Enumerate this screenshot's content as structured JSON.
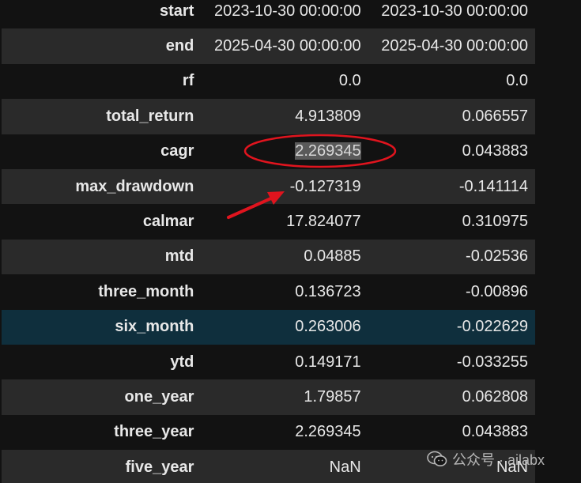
{
  "table": {
    "rows": [
      {
        "label": "start",
        "col1": "2023-10-30 00:00:00",
        "col2": "2023-10-30 00:00:00"
      },
      {
        "label": "end",
        "col1": "2025-04-30 00:00:00",
        "col2": "2025-04-30 00:00:00"
      },
      {
        "label": "rf",
        "col1": "0.0",
        "col2": "0.0"
      },
      {
        "label": "total_return",
        "col1": "4.913809",
        "col2": "0.066557"
      },
      {
        "label": "cagr",
        "col1": "2.269345",
        "col2": "0.043883"
      },
      {
        "label": "max_drawdown",
        "col1": "-0.127319",
        "col2": "-0.141114"
      },
      {
        "label": "calmar",
        "col1": "17.824077",
        "col2": "0.310975"
      },
      {
        "label": "mtd",
        "col1": "0.04885",
        "col2": "-0.02536"
      },
      {
        "label": "three_month",
        "col1": "0.136723",
        "col2": "-0.00896"
      },
      {
        "label": "six_month",
        "col1": "0.263006",
        "col2": "-0.022629"
      },
      {
        "label": "ytd",
        "col1": "0.149171",
        "col2": "-0.033255"
      },
      {
        "label": "one_year",
        "col1": "1.79857",
        "col2": "0.062808"
      },
      {
        "label": "three_year",
        "col1": "2.269345",
        "col2": "0.043883"
      },
      {
        "label": "five_year",
        "col1": "NaN",
        "col2": "NaN"
      }
    ],
    "highlighted_row": "six_month"
  },
  "annotation": {
    "color": "#e0141e"
  },
  "watermark": {
    "text": "公众号 · ailabx",
    "icon": "wechat-icon"
  },
  "colors": {
    "background": "#121212",
    "row_alt": "#2a2a2a",
    "row_highlight": "#0f2f3d",
    "text": "#e8e8e8"
  }
}
